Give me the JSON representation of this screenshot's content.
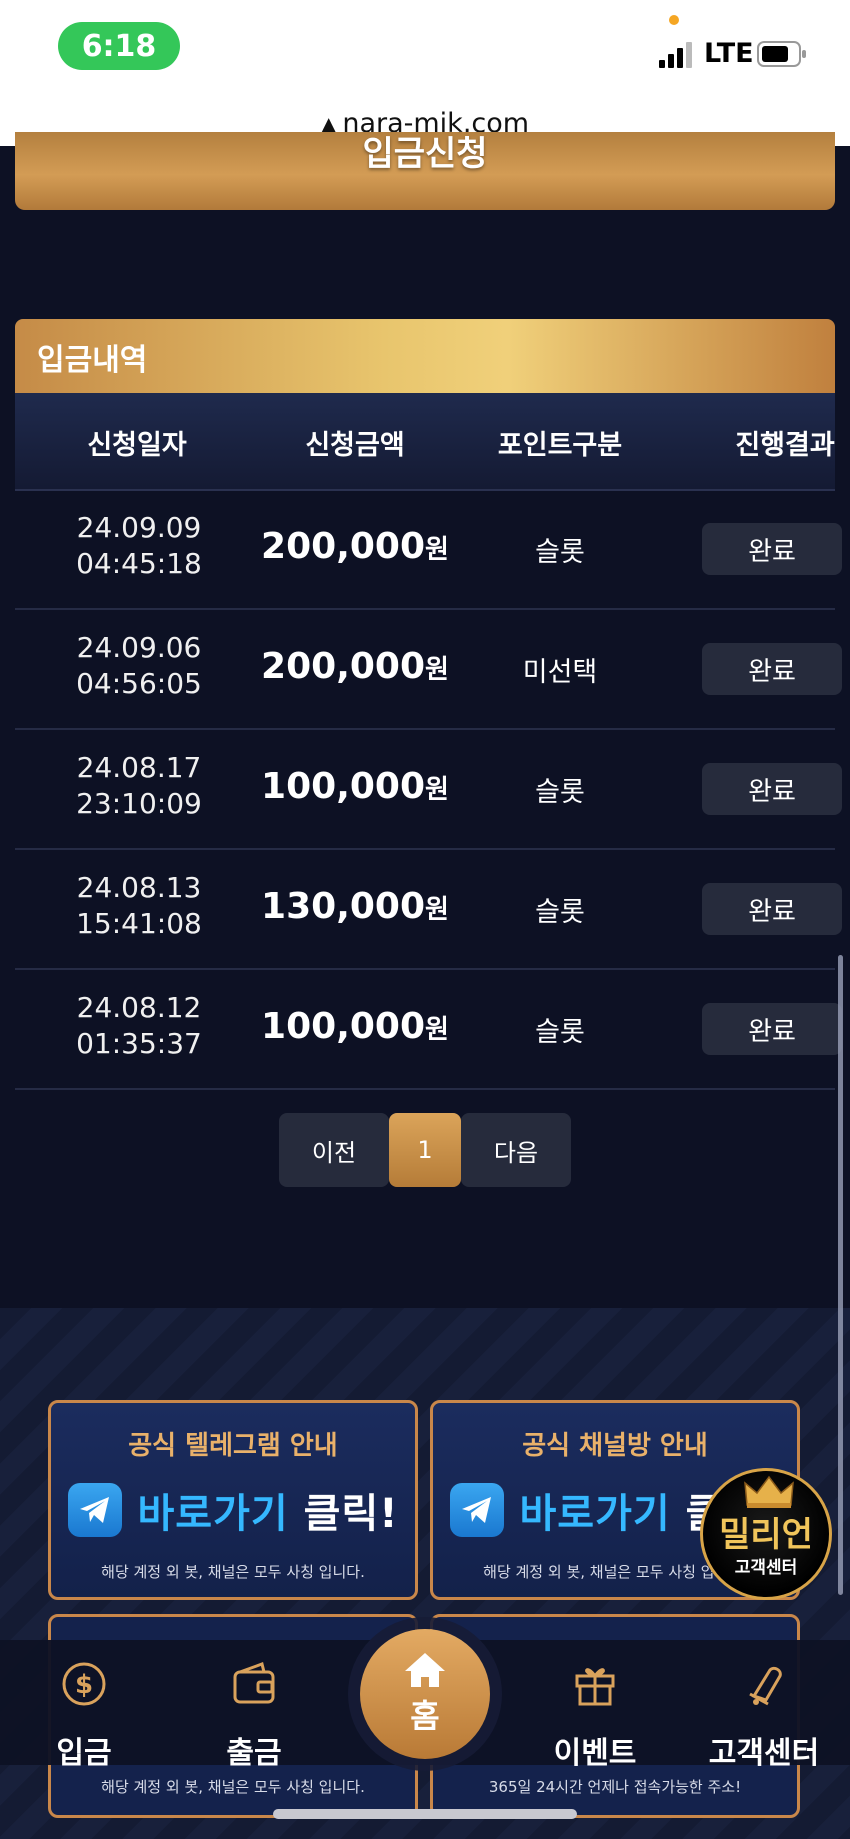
{
  "status_bar": {
    "time": "6:18",
    "network": "LTE"
  },
  "browser": {
    "url": "nara-mik.com"
  },
  "deposit_button_label": "입금신청",
  "history": {
    "title": "입금내역",
    "columns": [
      "신청일자",
      "신청금액",
      "포인트구분",
      "진행결과"
    ],
    "rows": [
      {
        "date": "24.09.09",
        "time": "04:45:18",
        "amount": "200,000",
        "currency": "원",
        "type": "슬롯",
        "status": "완료"
      },
      {
        "date": "24.09.06",
        "time": "04:56:05",
        "amount": "200,000",
        "currency": "원",
        "type": "미선택",
        "status": "완료"
      },
      {
        "date": "24.08.17",
        "time": "23:10:09",
        "amount": "100,000",
        "currency": "원",
        "type": "슬롯",
        "status": "완료"
      },
      {
        "date": "24.08.13",
        "time": "15:41:08",
        "amount": "130,000",
        "currency": "원",
        "type": "슬롯",
        "status": "완료"
      },
      {
        "date": "24.08.12",
        "time": "01:35:37",
        "amount": "100,000",
        "currency": "원",
        "type": "슬롯",
        "status": "완료"
      }
    ]
  },
  "pagination": {
    "prev": "이전",
    "current": "1",
    "next": "다음"
  },
  "banners": [
    {
      "title": "공식 텔레그램 안내",
      "cta_blue": "바로가기",
      "cta_white": "클릭!",
      "note": "해당 계정 외 봇, 채널은 모두 사칭 입니다."
    },
    {
      "title": "공식 채널방 안내",
      "cta_blue": "바로가기",
      "cta_white": "클릭!",
      "note": "해당 계정 외 봇, 채널은 모두 사칭 입니다."
    }
  ],
  "lower_banners": [
    {
      "note": "해당 계정 외 봇, 채널은 모두 사칭 입니다."
    },
    {
      "note": "365일 24시간 언제나 접속가능한 주소!"
    }
  ],
  "badge": {
    "title": "밀리언",
    "subtitle": "고객센터"
  },
  "bottom_nav": {
    "deposit": "입금",
    "withdraw": "출금",
    "home": "홈",
    "event": "이벤트",
    "support": "고객센터"
  },
  "colors": {
    "gold": "#c9874a",
    "navy": "#0d1124",
    "cta_blue": "#35b8ff"
  }
}
